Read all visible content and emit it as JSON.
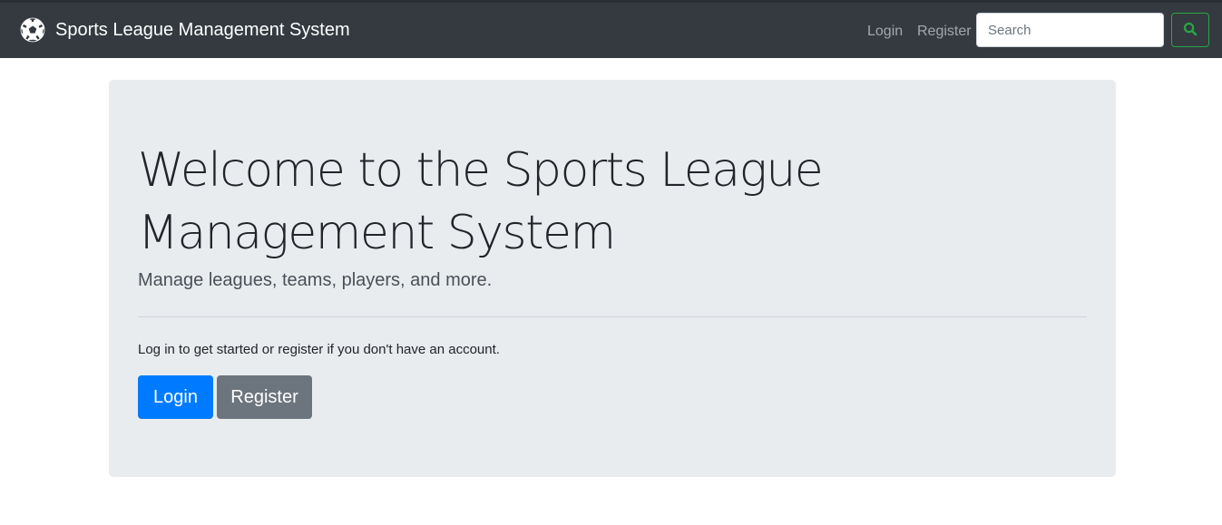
{
  "navbar": {
    "brand_text": "Sports League Management System",
    "brand_icon": "soccer-ball-icon",
    "links": {
      "login": "Login",
      "register": "Register"
    },
    "search": {
      "placeholder": "Search",
      "value": "",
      "button_icon": "search-icon",
      "button_color": "#28a745"
    },
    "background": "#343a40"
  },
  "hero": {
    "title": "Welcome to the Sports League Management System",
    "lead": "Manage leagues, teams, players, and more.",
    "info": "Log in to get started or register if you don't have an account.",
    "buttons": {
      "login": "Login",
      "register": "Register"
    },
    "colors": {
      "background": "#e9ecef",
      "primary": "#007bff",
      "secondary": "#6c757d"
    }
  }
}
